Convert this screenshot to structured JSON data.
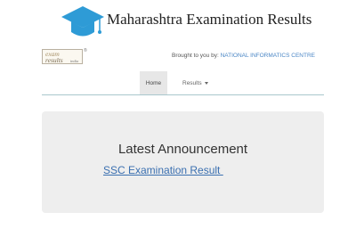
{
  "banner": {
    "title": "Maharashtra Examination Results",
    "icon": "graduation-cap-icon",
    "icon_color": "#2e9bd6"
  },
  "infobar": {
    "logo": {
      "line1": "exam",
      "line2": "results",
      "line3": "india",
      "mark": "®"
    },
    "brought_by": "Brought to you by: ",
    "provider": "NATIONAL INFORMATICS CENTRE"
  },
  "nav": {
    "home": "Home",
    "results": "Results"
  },
  "announcement": {
    "title": "Latest Announcement",
    "link": "SSC Examination Result "
  },
  "colors": {
    "link": "#3a6fb0",
    "provider": "#4a86c5",
    "panel": "#eeeeee"
  }
}
